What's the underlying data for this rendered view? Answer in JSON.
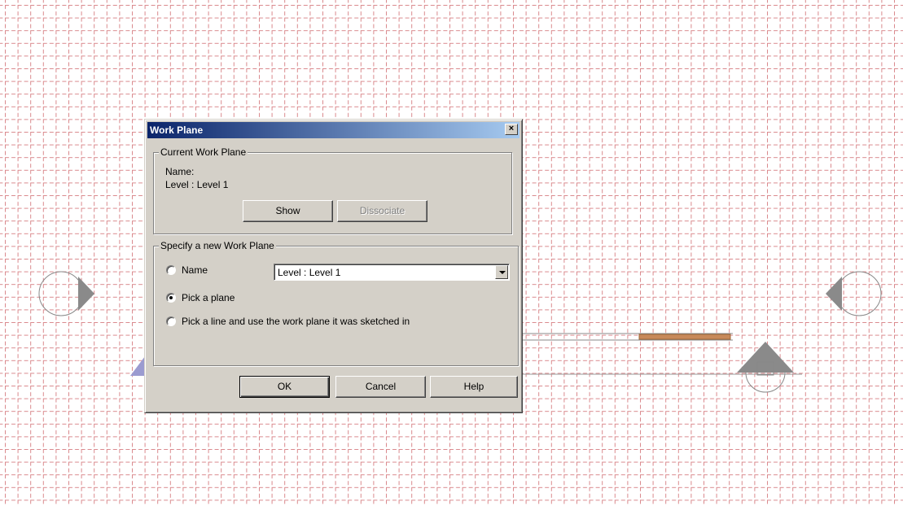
{
  "dialog": {
    "title": "Work Plane",
    "close_glyph": "×",
    "current_group": {
      "legend": "Current Work Plane",
      "name_label": "Name:",
      "name_value": "Level : Level 1",
      "show_label": "Show",
      "dissociate_label": "Dissociate"
    },
    "specify_group": {
      "legend": "Specify a new Work Plane",
      "options": [
        {
          "label": "Name",
          "checked": false
        },
        {
          "label": "Pick a plane",
          "checked": true
        },
        {
          "label": "Pick a line and use the work plane it was sketched in",
          "checked": false
        }
      ],
      "name_select_value": "Level : Level 1"
    },
    "footer": {
      "ok_label": "OK",
      "cancel_label": "Cancel",
      "help_label": "Help"
    }
  },
  "canvas": {
    "grid_color": "#d9888c",
    "beam_color": "#c8895a",
    "marker_color": "#9b9bd0"
  }
}
